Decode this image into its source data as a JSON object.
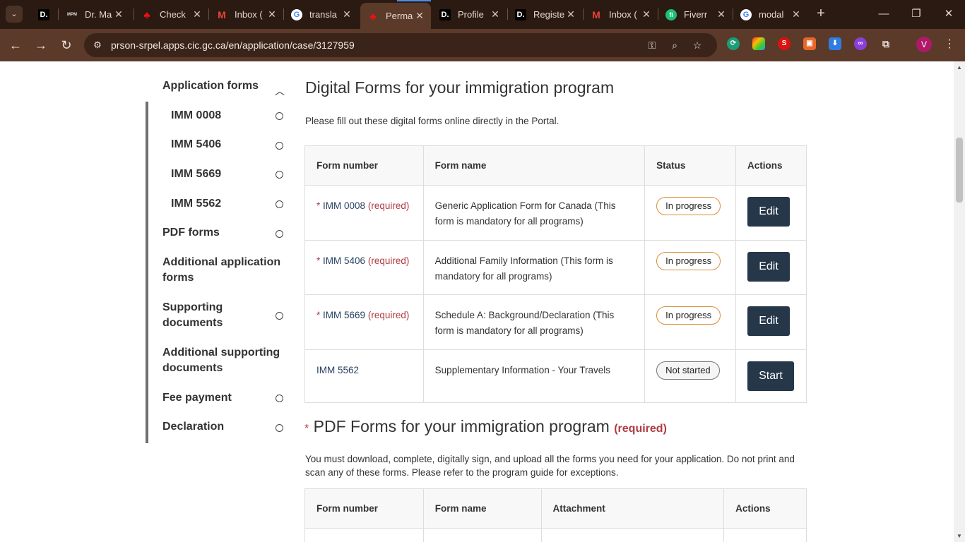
{
  "browser": {
    "tabs": [
      {
        "title": "",
        "favicon": "D."
      },
      {
        "title": "Dr. Ma",
        "favicon": "MPM"
      },
      {
        "title": "Check",
        "favicon": "maple-leaf"
      },
      {
        "title": "Inbox (",
        "favicon": "gmail"
      },
      {
        "title": "transla",
        "favicon": "google"
      },
      {
        "title": "Perma",
        "favicon": "maple-leaf"
      },
      {
        "title": "Profile",
        "favicon": "D."
      },
      {
        "title": "Registe",
        "favicon": "D."
      },
      {
        "title": "Inbox (",
        "favicon": "gmail"
      },
      {
        "title": "Fiverr",
        "favicon": "fiverr"
      },
      {
        "title": "modal",
        "favicon": "google"
      }
    ],
    "url": "prson-srpel.apps.cic.gc.ca/en/application/case/3127959",
    "avatar_letter": "V"
  },
  "sidebar": {
    "items": [
      {
        "label": "Application forms"
      },
      {
        "label": "IMM 0008"
      },
      {
        "label": "IMM 5406"
      },
      {
        "label": "IMM 5669"
      },
      {
        "label": "IMM 5562"
      },
      {
        "label": "PDF forms"
      },
      {
        "label": "Additional application forms"
      },
      {
        "label": "Supporting documents"
      },
      {
        "label": "Additional supporting documents"
      },
      {
        "label": "Fee payment"
      },
      {
        "label": "Declaration"
      }
    ]
  },
  "digital": {
    "title": "Digital Forms for your immigration program",
    "intro": "Please fill out these digital forms online directly in the Portal.",
    "headers": [
      "Form number",
      "Form name",
      "Status",
      "Actions"
    ],
    "rows": [
      {
        "star": "*",
        "number": "IMM 0008",
        "required": "(required)",
        "name": "Generic Application Form for Canada (This form is mandatory for all programs)",
        "status": "In progress",
        "action": "Edit"
      },
      {
        "star": "*",
        "number": "IMM 5406",
        "required": "(required)",
        "name": "Additional Family Information (This form is mandatory for all programs)",
        "status": "In progress",
        "action": "Edit"
      },
      {
        "star": "*",
        "number": "IMM 5669",
        "required": "(required)",
        "name": "Schedule A: Background/Declaration (This form is mandatory for all programs)",
        "status": "In progress",
        "action": "Edit"
      },
      {
        "star": "",
        "number": "IMM 5562",
        "required": "",
        "name": "Supplementary Information - Your Travels",
        "status": "Not started",
        "action": "Start"
      }
    ]
  },
  "pdf": {
    "star": "*",
    "title": "PDF Forms for your immigration program",
    "required": "(required)",
    "intro": "You must download, complete, digitally sign, and upload all the forms you need for your application. Do not print and scan any of these forms. Please refer to the program guide for exceptions.",
    "headers": [
      "Form number",
      "Form name",
      "Attachment",
      "Actions"
    ]
  }
}
